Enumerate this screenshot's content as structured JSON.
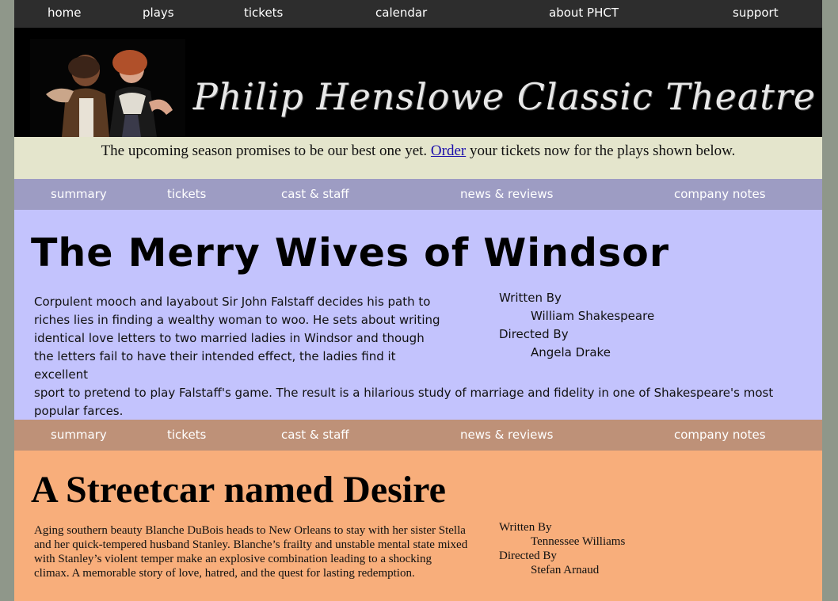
{
  "top_nav": [
    "home",
    "plays",
    "tickets",
    "calendar",
    "about PHCT",
    "support"
  ],
  "banner": {
    "logo_text": "Philip Henslowe Classic Theatre"
  },
  "promo": {
    "before": "The upcoming season promises to be our best one yet. ",
    "link": "Order",
    "after": " your tickets now for the plays shown below."
  },
  "play_nav": [
    "summary",
    "tickets",
    "cast & staff",
    "news & reviews",
    "company notes"
  ],
  "plays": [
    {
      "title": "The Merry Wives of Windsor",
      "synopsis_part1": "Corpulent mooch and layabout Sir John Falstaff decides his path to riches lies in finding a wealthy woman to woo. He sets about writing identical love letters to two married ladies in Windsor and though the letters fail to have their intended effect, the ladies find it excellent",
      "synopsis_part2": "sport to pretend to play Falstaff's game. The result is a hilarious study of marriage and fidelity in one of Shakespeare's most popular farces.",
      "written_by_label": "Written By",
      "author": "William Shakespeare",
      "directed_by_label": "Directed By",
      "director": "Angela Drake"
    },
    {
      "title": "A Streetcar named Desire",
      "synopsis": "Aging southern beauty Blanche DuBois heads to New Orleans to stay with her sister Stella and her quick-tempered husband Stanley. Blanche’s frailty and unstable mental state mixed with Stanley’s violent temper make an explosive combination leading to a shocking climax. A memorable story of love, hatred, and the quest for lasting redemption.",
      "written_by_label": "Written By",
      "author": "Tennessee Williams",
      "directed_by_label": "Directed By",
      "director": "Stefan Arnaud"
    }
  ]
}
